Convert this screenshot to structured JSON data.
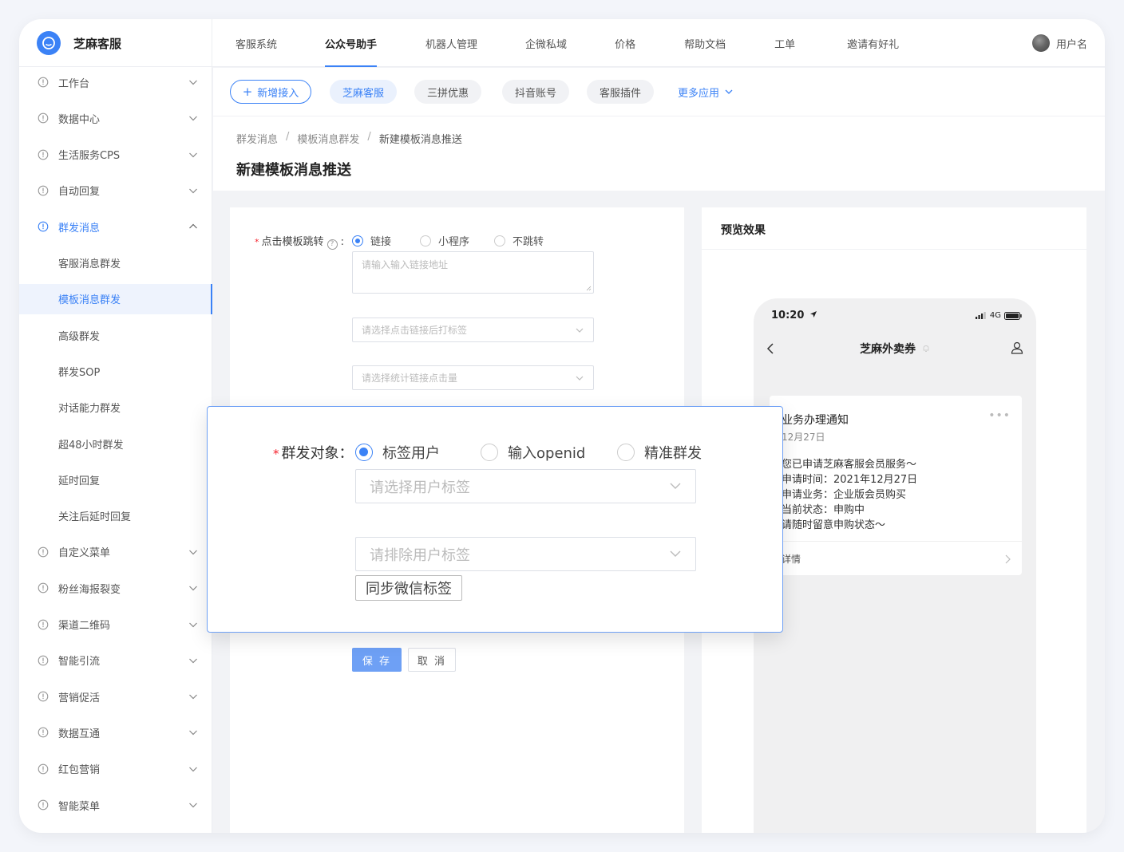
{
  "app": {
    "logo_text": "芝麻客服"
  },
  "topnav": {
    "items": [
      {
        "label": "客服系统"
      },
      {
        "label": "公众号助手"
      },
      {
        "label": "机器人管理"
      },
      {
        "label": "企微私域"
      },
      {
        "label": "价格"
      },
      {
        "label": "帮助文档"
      },
      {
        "label": "工单"
      },
      {
        "label": "邀请有好礼"
      }
    ],
    "active_index": 1,
    "username": "用户名"
  },
  "sidebar": {
    "items": [
      {
        "label": "工作台"
      },
      {
        "label": "数据中心"
      },
      {
        "label": "生活服务CPS"
      },
      {
        "label": "自动回复"
      },
      {
        "label": "群发消息"
      },
      {
        "label": "自定义菜单"
      },
      {
        "label": "粉丝海报裂变"
      },
      {
        "label": "渠道二维码"
      },
      {
        "label": "智能引流"
      },
      {
        "label": "营销促活"
      },
      {
        "label": "数据互通"
      },
      {
        "label": "红包营销"
      },
      {
        "label": "智能菜单"
      }
    ],
    "sub_items": [
      {
        "label": "客服消息群发"
      },
      {
        "label": "模板消息群发"
      },
      {
        "label": "高级群发"
      },
      {
        "label": "群发SOP"
      },
      {
        "label": "对话能力群发"
      },
      {
        "label": "超48小时群发"
      },
      {
        "label": "延时回复"
      },
      {
        "label": "关注后延时回复"
      }
    ]
  },
  "tabs": {
    "add_label": "新增接入",
    "accounts": [
      {
        "label": "芝麻客服"
      },
      {
        "label": "三拼优惠"
      },
      {
        "label": "抖音账号"
      },
      {
        "label": "客服插件"
      }
    ],
    "more_label": "更多应用"
  },
  "breadcrumb": {
    "l1": "群发消息",
    "l2": "模板消息群发",
    "l3": "新建模板消息推送",
    "sep": "/"
  },
  "page_title": "新建模板消息推送",
  "form": {
    "jump_label": "点击模板跳转",
    "jump_options": [
      {
        "label": "链接"
      },
      {
        "label": "小程序"
      },
      {
        "label": "不跳转"
      }
    ],
    "link_placeholder": "请输入输入链接地址",
    "tag_after_click_placeholder": "请选择点击链接后打标签",
    "stat_placeholder": "请选择统计链接点击量",
    "save_label": "保 存",
    "cancel_label": "取 消"
  },
  "overlay": {
    "target_label": "群发对象：",
    "options": [
      {
        "label": "标签用户"
      },
      {
        "label": "输入openid"
      },
      {
        "label": "精准群发"
      }
    ],
    "select_tag_placeholder": "请选择用户标签",
    "exclude_tag_placeholder": "请排除用户标签",
    "sync_button": "同步微信标签"
  },
  "preview": {
    "title": "预览效果",
    "time": "10:20",
    "network": "4G",
    "account_name": "芝麻外卖券",
    "msg_title": "业务办理通知",
    "msg_date": "12月27日",
    "msg_lines": [
      "您已申请芝麻客服会员服务～",
      "申请时间：2021年12月27日",
      "申请业务：企业版会员购买",
      "当前状态：申购中",
      "请随时留意申购状态～"
    ],
    "detail_label": "详情",
    "more_dots": "•••"
  },
  "colors": {
    "accent": "#3b82f6",
    "save_button": "#6ea0f5",
    "required": "#f5222d"
  }
}
